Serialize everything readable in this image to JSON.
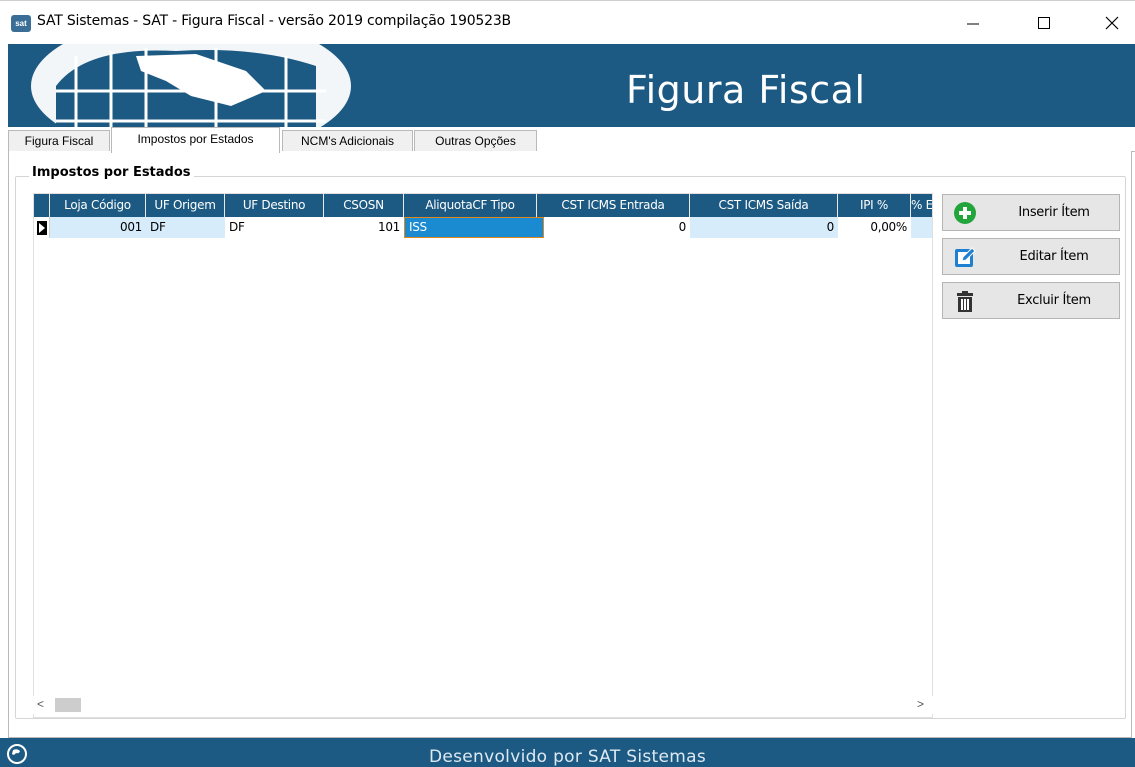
{
  "window": {
    "title": "SAT Sistemas - SAT - Figura Fiscal - versão 2019 compilação 190523B",
    "minimize_glyph": "—",
    "maximize_glyph": "☐",
    "close_glyph": "✕"
  },
  "banner": {
    "title": "Figura Fiscal"
  },
  "tabs": [
    {
      "label": "Figura Fiscal"
    },
    {
      "label": "Impostos por Estados"
    },
    {
      "label": "NCM's Adicionais"
    },
    {
      "label": "Outras Opções"
    }
  ],
  "active_tab": "Impostos por Estados",
  "group": {
    "title": "Impostos por Estados"
  },
  "grid": {
    "columns": [
      "Loja Código",
      "UF Origem",
      "UF Destino",
      "CSOSN",
      "AliquotaCF Tipo",
      "CST ICMS Entrada",
      "CST ICMS Saída",
      "IPI %",
      "% E"
    ],
    "rows": [
      {
        "loja_codigo": "001",
        "uf_origem": "DF",
        "uf_destino": "DF",
        "csosn": "101",
        "aliquota_cf_tipo": "ISS",
        "cst_icms_entrada": "0",
        "cst_icms_saida": "0",
        "ipi": "0,00%"
      }
    ]
  },
  "scrollbar": {
    "left_arrow": "<",
    "right_arrow": ">"
  },
  "actions": {
    "insert_label": "Inserir Ítem",
    "edit_label": "Editar Ítem",
    "delete_label": "Excluir Ítem"
  },
  "footer": {
    "text": "Desenvolvido por SAT Sistemas"
  },
  "colors": {
    "brand_blue": "#1c5a83",
    "row_highlight": "#d7ecfb",
    "selection": "#1a8bd0",
    "add_green": "#22a53a",
    "edit_blue": "#1f7fd1"
  },
  "icons": {
    "app": "sat-app-icon",
    "insert": "plus-circle-icon",
    "edit": "edit-pencil-icon",
    "delete": "trash-icon",
    "footer": "globe-icon",
    "row_indicator": "row-pointer-icon"
  }
}
